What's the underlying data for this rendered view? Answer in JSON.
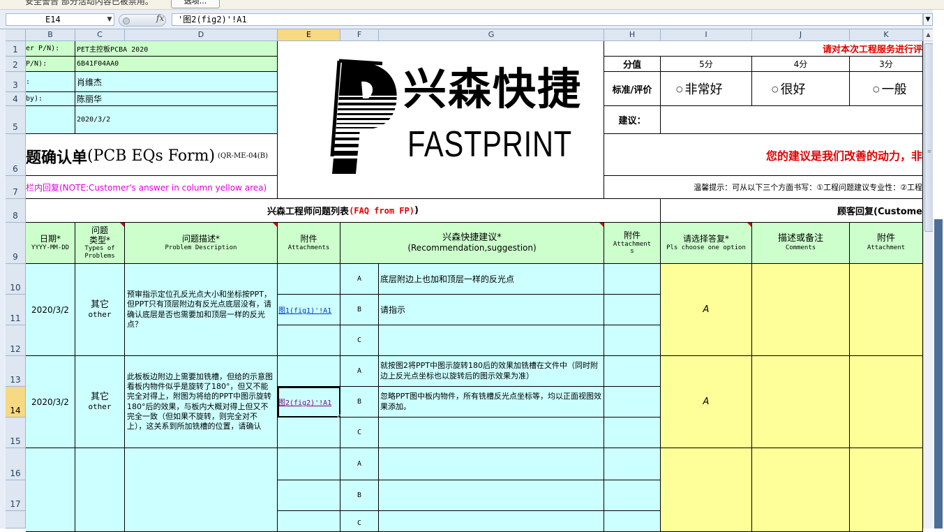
{
  "security_bar": {
    "text": "安全警告 部分活动内容已被禁用。",
    "button": "选项..."
  },
  "formula_bar": {
    "name_box": "E14",
    "fx_label": "fx",
    "formula": "'图2(fig2)'!A1"
  },
  "columns": [
    "B",
    "C",
    "D",
    "E",
    "F",
    "G",
    "H",
    "I",
    "J",
    "K"
  ],
  "selected_column": "E",
  "rows": [
    "1",
    "2",
    "3",
    "4",
    "5",
    "6",
    "7",
    "8",
    "9",
    "10",
    "11",
    "12",
    "13",
    "14",
    "15",
    "16",
    "17"
  ],
  "selected_row": "14",
  "header_info": {
    "labels": [
      "er P/N):",
      " P/N):",
      ":",
      "by):",
      ""
    ],
    "values": [
      "PET主控板PCBA 2020",
      "6B41F04AA0",
      "肖维杰",
      "陈丽华",
      "2020/3/2"
    ]
  },
  "form_title": {
    "main": "题确认单",
    "en": "(PCB EQs Form)",
    "code": "(QR-ME-04(B)"
  },
  "note_line": "栏内回复(NOTE:Customer's answer in column yellow area)",
  "logo": {
    "cn": "兴森快捷",
    "en": "FASTPRINT"
  },
  "rating": {
    "invite": "请对本次工程服务进行评",
    "score_label": "分值",
    "scores": [
      "5分",
      "4分",
      "3分"
    ],
    "eval_label": "标准/评价",
    "options": [
      "非常好",
      "很好",
      "一般"
    ],
    "suggest_label": "建议：",
    "motto": "您的建议是我们改善的动力，非",
    "tip": "温馨提示：可从以下三个方面书写：①工程问题建议专业性：②工程"
  },
  "sections": {
    "fp_title": "兴森工程师问题列表",
    "fp_title_red": "(FAQ from FP)",
    "fp_title_end": ")",
    "customer_title": "顾客回复(Custome"
  },
  "table_headers": {
    "date": [
      "日期*",
      "YYYY-MM-DD"
    ],
    "type": [
      "问题",
      "类型*",
      "Types of",
      "Problems"
    ],
    "desc": [
      "问题描述*",
      "Problem Description"
    ],
    "attach": [
      "附件",
      "Attachments"
    ],
    "recommend": [
      "兴森快捷建议*",
      "(Recommendation,suggestion)"
    ],
    "attach2": [
      "附件",
      "Attachment",
      "s"
    ],
    "choose": [
      "请选择答复*",
      "Pls choose one option"
    ],
    "comments": [
      "描述或备注",
      "Comments"
    ],
    "attach3": [
      "附件",
      "Attachment"
    ]
  },
  "issues": [
    {
      "date": "2020/3/2",
      "type_cn": "其它",
      "type_en": "other",
      "description": "预审指示定位孔反光点大小和坐标按PPT，但PPT只有顶层附边有反光点底层没有，请确认底层是否也需要加和顶层一样的反光点？",
      "attachment": "图1(fig1)'!A1",
      "options": [
        {
          "letter": "A",
          "text": "底层附边上也加和顶层一样的反光点"
        },
        {
          "letter": "B",
          "text": "请指示"
        },
        {
          "letter": "C",
          "text": ""
        }
      ],
      "answer": "A"
    },
    {
      "date": "2020/3/2",
      "type_cn": "其它",
      "type_en": "other",
      "description": "此板板边附边上需要加铣槽，但给的示意图看板内物件似乎是旋转了180°，但又不能完全对得上，附图为将给的PPT中图示旋转180°后的效果，与板内大概对得上但又不完全一致（但如果不旋转，则完全对不上），这关系到所加铣槽的位置，请确认",
      "attachment": "图2(fig2)'!A1",
      "options": [
        {
          "letter": "A",
          "text": "就按图2将PPT中图示旋转180后的效果加铣槽在文件中（同时附边上反光点坐标也以旋转后的图示效果为准）"
        },
        {
          "letter": "B",
          "text": "忽略PPT图中板内物件，所有铣槽反光点坐标等，均以正面视图效果添加。"
        },
        {
          "letter": "C",
          "text": ""
        }
      ],
      "answer": "A"
    },
    {
      "date": "",
      "type_cn": "",
      "type_en": "",
      "description": "",
      "attachment": "",
      "options": [
        {
          "letter": "A",
          "text": ""
        },
        {
          "letter": "B",
          "text": ""
        },
        {
          "letter": "C",
          "text": ""
        }
      ],
      "answer": ""
    }
  ]
}
